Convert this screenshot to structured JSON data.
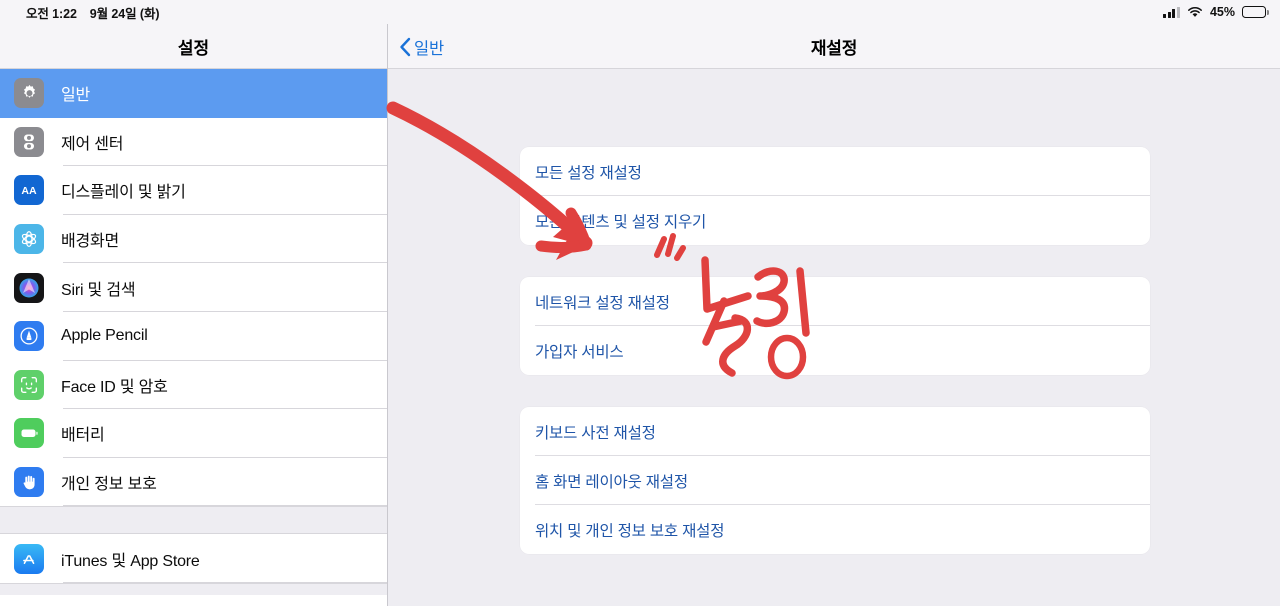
{
  "status_bar": {
    "time": "오전 1:22",
    "date": "9월 24일 (화)",
    "battery_percent": "45%",
    "battery_level": 45,
    "signal_icon": "cellular-signal-icon",
    "wifi_icon": "wifi-icon",
    "battery_icon": "battery-icon"
  },
  "sidebar": {
    "title": "설정",
    "items": [
      {
        "label": "일반",
        "icon": "gear-icon",
        "selected": true
      },
      {
        "label": "제어 센터",
        "icon": "control-center-icon",
        "selected": false
      },
      {
        "label": "디스플레이 및 밝기",
        "icon": "display-brightness-icon",
        "selected": false
      },
      {
        "label": "배경화면",
        "icon": "wallpaper-icon",
        "selected": false
      },
      {
        "label": "Siri 및 검색",
        "icon": "siri-icon",
        "selected": false
      },
      {
        "label": "Apple Pencil",
        "icon": "apple-pencil-icon",
        "selected": false
      },
      {
        "label": "Face ID 및 암호",
        "icon": "face-id-icon",
        "selected": false
      },
      {
        "label": "배터리",
        "icon": "battery-settings-icon",
        "selected": false
      },
      {
        "label": "개인 정보 보호",
        "icon": "privacy-hand-icon",
        "selected": false
      }
    ],
    "items_group2": [
      {
        "label": "iTunes 및 App Store",
        "icon": "app-store-icon",
        "selected": false
      }
    ]
  },
  "detail": {
    "back_label": "일반",
    "back_icon": "chevron-left-icon",
    "title": "재설정",
    "groups": [
      {
        "rows": [
          {
            "label": "모든 설정 재설정"
          },
          {
            "label": "모든 콘텐츠 및 설정 지우기"
          }
        ]
      },
      {
        "rows": [
          {
            "label": "네트워크 설정 재설정"
          },
          {
            "label": "가입자 서비스"
          }
        ]
      },
      {
        "rows": [
          {
            "label": "키보드 사전 재설정"
          },
          {
            "label": "홈 화면 레이아웃 재설정"
          },
          {
            "label": "위치 및 개인 정보 보호 재설정"
          }
        ]
      }
    ]
  },
  "annotations": {
    "arrow": {
      "name": "red-arrow-annotation",
      "color": "#e0413f",
      "points_to": "네트워크 설정 재설정"
    },
    "handwriting": {
      "name": "handwritten-note",
      "text": "누름",
      "color": "#e0413f"
    }
  },
  "colors": {
    "accent_blue": "#1f55a8",
    "selected_row": "#5c9bf0",
    "link_blue": "#1a72d8",
    "background": "#eeedf2",
    "card": "#ffffff",
    "annotation_red": "#e0413f"
  }
}
